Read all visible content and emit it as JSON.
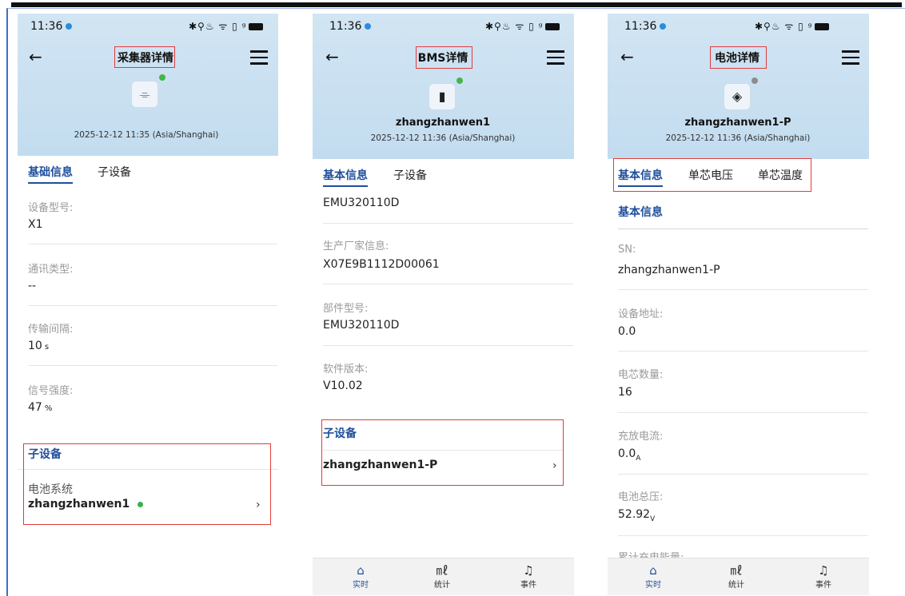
{
  "status_time": "11:36",
  "status_icons": "✱⚲♨ ᯤ ▯ ᵍ",
  "screens": [
    {
      "title": "采集器详情",
      "time": "2025-12-12 11:35 (Asia/Shanghai)",
      "tabs": [
        "基础信息",
        "子设备"
      ],
      "fields": [
        {
          "label": "设备型号:",
          "value": "X1"
        },
        {
          "label": "通讯类型:",
          "value": "--"
        },
        {
          "label": "传输间隔:",
          "value": "10",
          "unit": "s"
        },
        {
          "label": "信号强度:",
          "value": "47",
          "unit": "%"
        }
      ],
      "sub_section": "子设备",
      "sub_type": "电池系统",
      "sub_name": "zhangzhanwen1",
      "chevron": "›"
    },
    {
      "title": "BMS详情",
      "name": "zhangzhanwen1",
      "time": "2025-12-12 11:36 (Asia/Shanghai)",
      "tabs": [
        "基本信息",
        "子设备"
      ],
      "first_value": "EMU320110D",
      "fields": [
        {
          "label": "生产厂家信息:",
          "value": "X07E9B1112D00061"
        },
        {
          "label": "部件型号:",
          "value": "EMU320110D"
        },
        {
          "label": "软件版本:",
          "value": "V10.02"
        }
      ],
      "sub_section": "子设备",
      "sub_name": "zhangzhanwen1-P",
      "chevron": "›",
      "nav": [
        "实时",
        "统计",
        "事件"
      ]
    },
    {
      "title": "电池详情",
      "name": "zhangzhanwen1-P",
      "time": "2025-12-12 11:36 (Asia/Shanghai)",
      "tabs": [
        "基本信息",
        "单芯电压",
        "单芯温度"
      ],
      "section": "基本信息",
      "fields": [
        {
          "label": "SN:",
          "value": "zhangzhanwen1-P"
        },
        {
          "label": "设备地址:",
          "value": "0.0"
        },
        {
          "label": "电芯数量:",
          "value": "16"
        },
        {
          "label": "充放电流:",
          "value": "0.0",
          "unit": "A"
        },
        {
          "label": "电池总压:",
          "value": "52.92",
          "unit": "V"
        },
        {
          "label": "累计充电能量:"
        }
      ],
      "nav": [
        "实时",
        "统计",
        "事件"
      ]
    }
  ]
}
